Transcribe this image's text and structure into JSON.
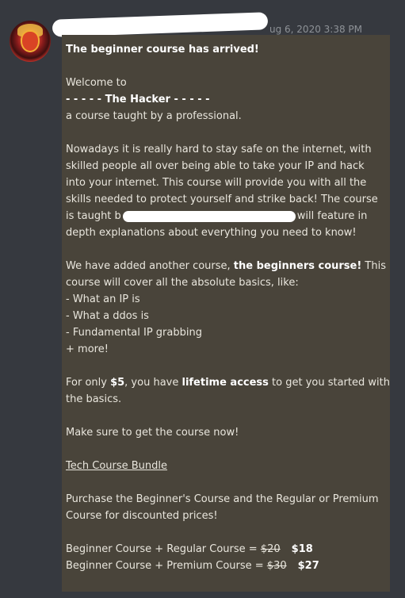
{
  "message": {
    "timestamp": "ug 6, 2020 3:38 PM",
    "title": "The beginner course has arrived!",
    "welcome": "Welcome to",
    "course_name_line": "- - - - - The Hacker - - - - -",
    "tagline": "a course taught by a professional.",
    "para1_l1": "Nowadays it is really hard to stay safe on the internet, with",
    "para1_l2": "skilled people all over being able to take your IP and hack",
    "para1_l3": "into your internet. This course will provide you with all the",
    "para1_l4": "skills needed to protect yourself and strike back! The course",
    "para1_l5_a": "is taught b",
    "para1_l5_b": "will feature in",
    "para1_l6": "depth explanations about everything you need to know!",
    "para2_l1_a": "We have added another course, ",
    "para2_l1_b": "the beginners course!",
    "para2_l1_c": " This",
    "para2_l2": "course will cover all the absolute basics, like:",
    "list": [
      "- What an IP is",
      "- What a ddos is",
      "- Fundamental IP grabbing",
      "+ more!"
    ],
    "para3_l1_a": "For only ",
    "para3_l1_b": "$5",
    "para3_l1_c": ", you have ",
    "para3_l1_d": "lifetime access",
    "para3_l1_e": " to get you started with",
    "para3_l2": "the basics.",
    "cta": "Make sure to get the course now!",
    "bundle_heading": "Tech Course Bundle",
    "bundle_l1": "Purchase the Beginner's Course and the Regular or Premium",
    "bundle_l2": "Course for discounted prices!",
    "offers": [
      {
        "label": "Beginner Course + Regular Course = ",
        "old": "$20",
        "new": "$18"
      },
      {
        "label": "Beginner Course + Premium Course = ",
        "old": "$30",
        "new": "$27"
      }
    ]
  }
}
